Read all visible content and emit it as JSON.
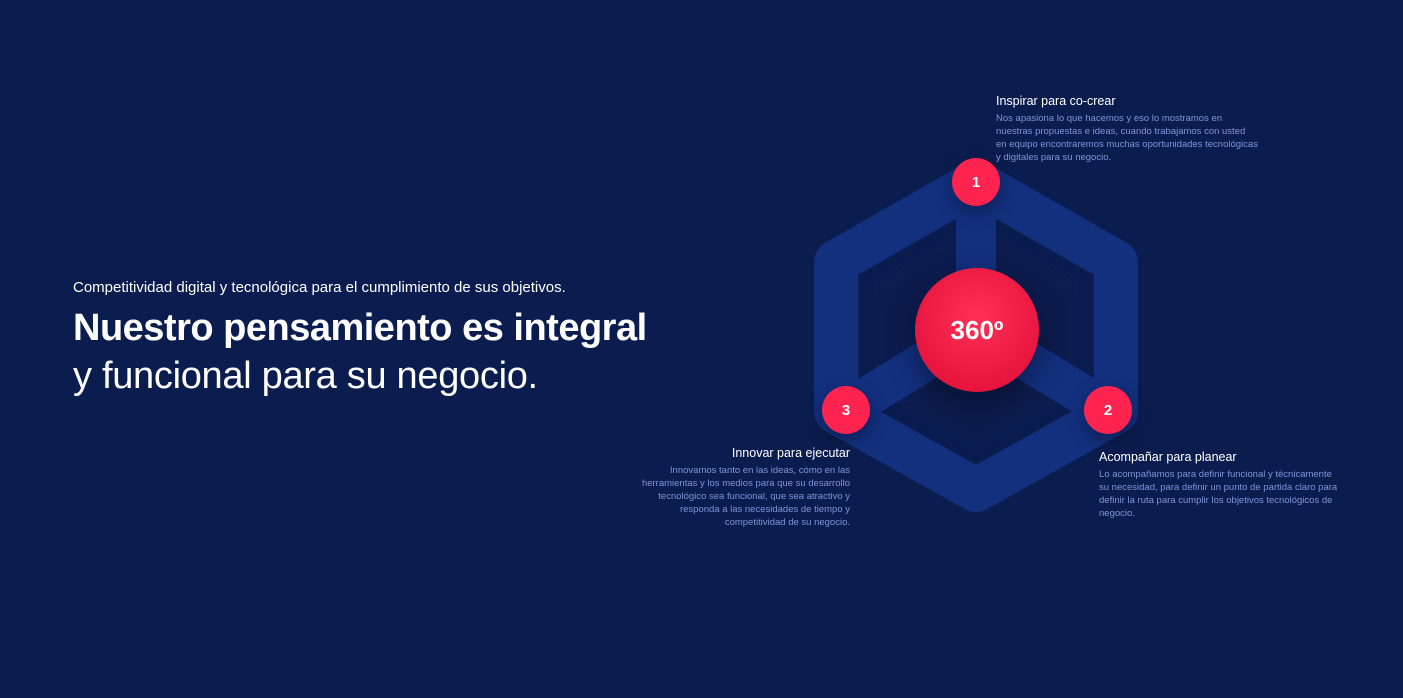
{
  "hero": {
    "kicker": "Competitividad digital y tecnológica para el cumplimiento de sus objetivos.",
    "title_bold": "Nuestro pensamiento es integral",
    "title_light": "y funcional para su negocio."
  },
  "diagram": {
    "center_label": "360º",
    "colors": {
      "background": "#0b1d4f",
      "hexagon": "#13307f",
      "accent": "#ff2450",
      "body_text": "#7f95d8"
    },
    "steps": [
      {
        "number": "1",
        "title": "Inspirar para co-crear",
        "body": "Nos apasiona lo que hacemos y eso lo mostramos en nuestras propuestas e ideas, cuando trabajamos con usted en equipo encontraremos muchas oportunidades tecnológicas y digitales para su negocio."
      },
      {
        "number": "2",
        "title": "Acompañar para planear",
        "body": "Lo acompañamos para definir funcional y técnicamente su necesidad, para definir un punto de partida claro para definir la ruta para cumplir los objetivos tecnológicos de negocio."
      },
      {
        "number": "3",
        "title": "Innovar para ejecutar",
        "body": "Innovamos tanto en las ideas, cómo en las herramientas y los medios para que su desarrollo tecnológico sea funcional, que sea atractivo y responda a las necesidades de tiempo y competitividad de su negocio."
      }
    ]
  }
}
